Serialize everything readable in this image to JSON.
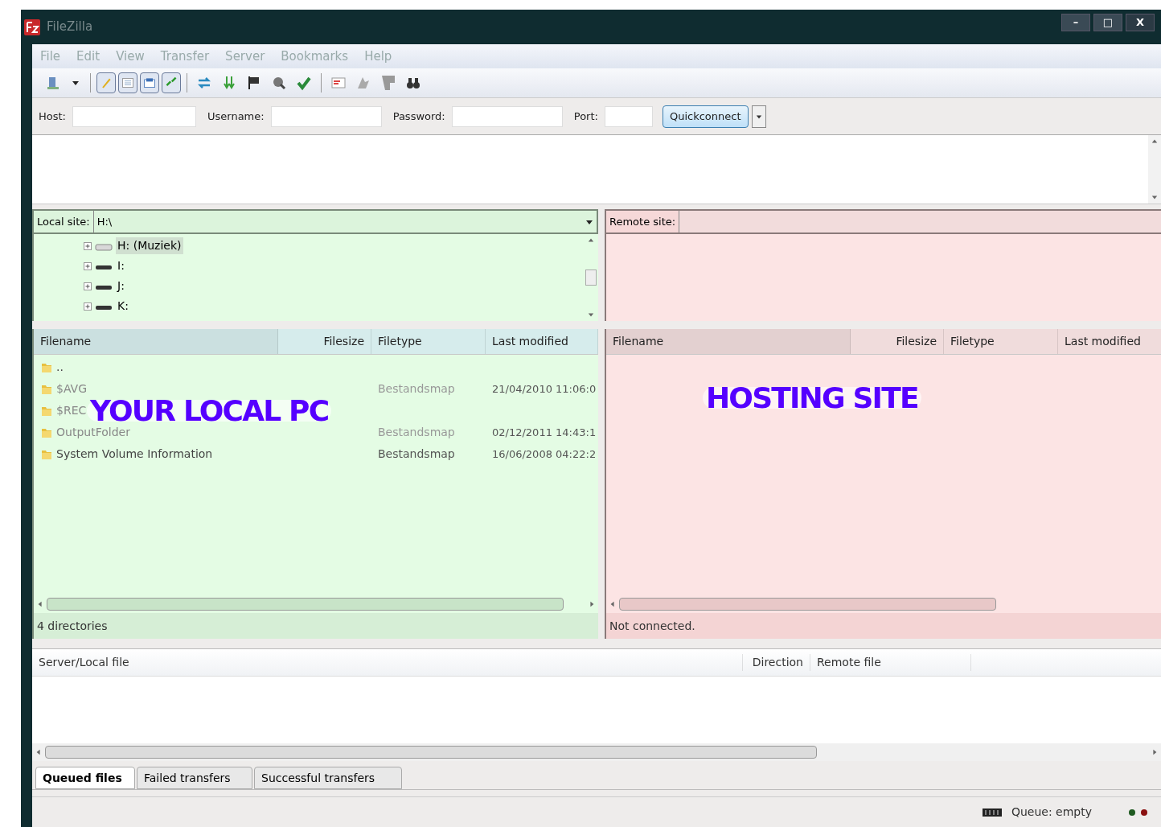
{
  "window": {
    "title": "FileZilla",
    "controls": [
      "–",
      "□",
      "X"
    ]
  },
  "menu": [
    "File",
    "Edit",
    "View",
    "Transfer",
    "Server",
    "Bookmarks",
    "Help"
  ],
  "toolbar": [
    {
      "pressed": false
    },
    {
      "pressed": false
    },
    {
      "pressed": true
    },
    {
      "pressed": true
    },
    {
      "pressed": true
    },
    {
      "pressed": true
    },
    {
      "pressed": false
    },
    {
      "pressed": false
    },
    {
      "pressed": false
    },
    {
      "pressed": false
    },
    {
      "pressed": false
    },
    {
      "pressed": false
    },
    {
      "pressed": false
    },
    {
      "pressed": false
    },
    {
      "pressed": false
    }
  ],
  "quickconnect": {
    "fields": [
      {
        "label": "Host:"
      },
      {
        "label": "Username:"
      },
      {
        "label": "Password:"
      },
      {
        "label": "Port:"
      }
    ],
    "button": "Quickconnect"
  },
  "local": {
    "label": "Local site:",
    "path": "H:\\",
    "tree": [
      {
        "label": "H: (Muziek)",
        "selected": true
      },
      {
        "label": "I:",
        "selected": false
      },
      {
        "label": "J:",
        "selected": false
      },
      {
        "label": "K:",
        "selected": false
      }
    ],
    "columns": [
      "Filename",
      "Filesize",
      "Filetype",
      "Last modified"
    ],
    "rows": [
      {
        "filename": ".."
      },
      {
        "filename": "$AVG",
        "filetype": "Bestandsmap",
        "modified": "21/04/2010 11:06:0"
      },
      {
        "filename": "$REC"
      },
      {
        "filename": "OutputFolder",
        "filetype": "Bestandsmap",
        "modified": "02/12/2011 14:43:1"
      },
      {
        "filename": "System Volume Information",
        "filetype": "Bestandsmap",
        "modified": "16/06/2008 04:22:2"
      }
    ],
    "overlay": "YOUR LOCAL PC",
    "status": "4 directories"
  },
  "remote": {
    "label": "Remote site:",
    "columns": [
      "Filename",
      "Filesize",
      "Filetype",
      "Last modified"
    ],
    "overlay": "HOSTING SITE",
    "status": "Not connected."
  },
  "queue": {
    "columns": [
      "Server/Local file",
      "Direction",
      "Remote file"
    ],
    "tabs": [
      {
        "label": "Queued files",
        "selected": true
      },
      {
        "label": "Failed transfers",
        "selected": false
      },
      {
        "label": "Successful transfers",
        "selected": false
      }
    ]
  },
  "status_bar": {
    "queue": "Queue: empty"
  }
}
